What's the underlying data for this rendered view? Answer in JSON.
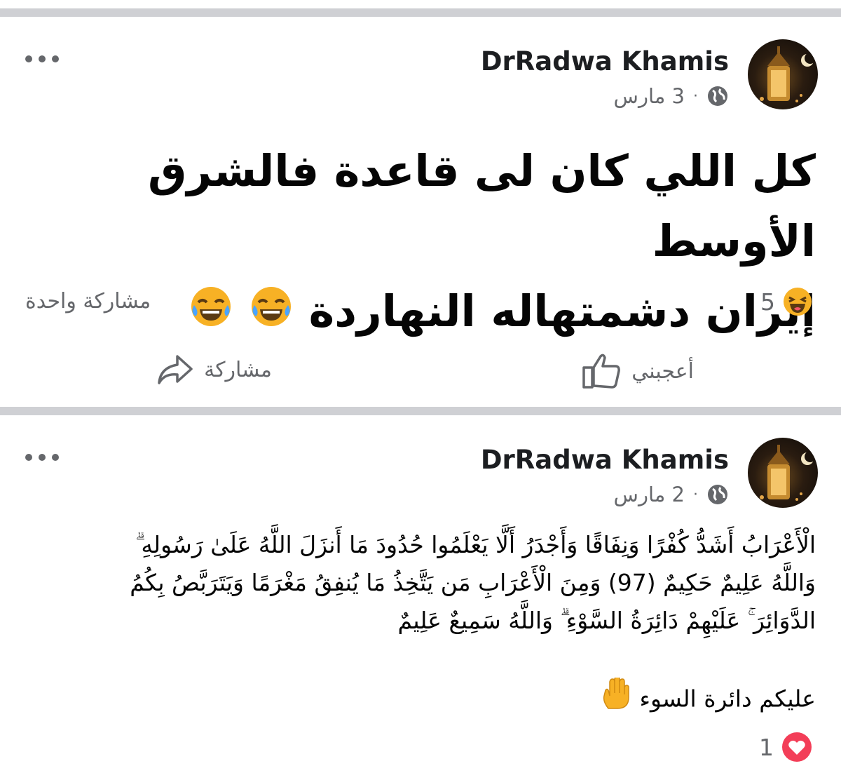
{
  "posts": [
    {
      "author": "DrRadwa Khamis",
      "date": "3 مارس",
      "separator": "·",
      "text_line1": "كل اللي كان لى قاعدة فالشرق الأوسط",
      "text_line2": "إيران دشمتهاله النهاردة",
      "reaction_count": "5",
      "reaction_icon": "haha-reaction-icon",
      "shares_text": "مشاركة واحدة",
      "like_label": "أعجبني",
      "share_label": "مشاركة"
    },
    {
      "author": "DrRadwa Khamis",
      "date": "2 مارس",
      "separator": "·",
      "verse_line1": "الْأَعْرَابُ أَشَدُّ كُفْرًا وَنِفَاقًا وَأَجْدَرُ أَلَّا يَعْلَمُوا حُدُودَ مَا أَنزَلَ اللَّهُ عَلَىٰ رَسُولِهِ ۗ",
      "verse_line2": "وَاللَّهُ عَلِيمٌ حَكِيمٌ (97) وَمِنَ الْأَعْرَابِ مَن يَتَّخِذُ مَا يُنفِقُ مَغْرَمًا وَيَتَرَبَّصُ بِكُمُ",
      "verse_line3": "الدَّوَائِرَ ۚ عَلَيْهِمْ دَائِرَةُ السَّوْءِ ۗ وَاللَّهُ سَمِيعٌ عَلِيمٌ",
      "comment_line": "عليكم دائرة السوء",
      "reaction_count": "1",
      "reaction_icon": "love-reaction-icon"
    }
  ],
  "colors": {
    "divider": "#cfd0d4",
    "secondary_text": "#65676b",
    "primary_text": "#050505",
    "love_red": "#f33e58",
    "emoji_yellow": "#f7b125"
  }
}
